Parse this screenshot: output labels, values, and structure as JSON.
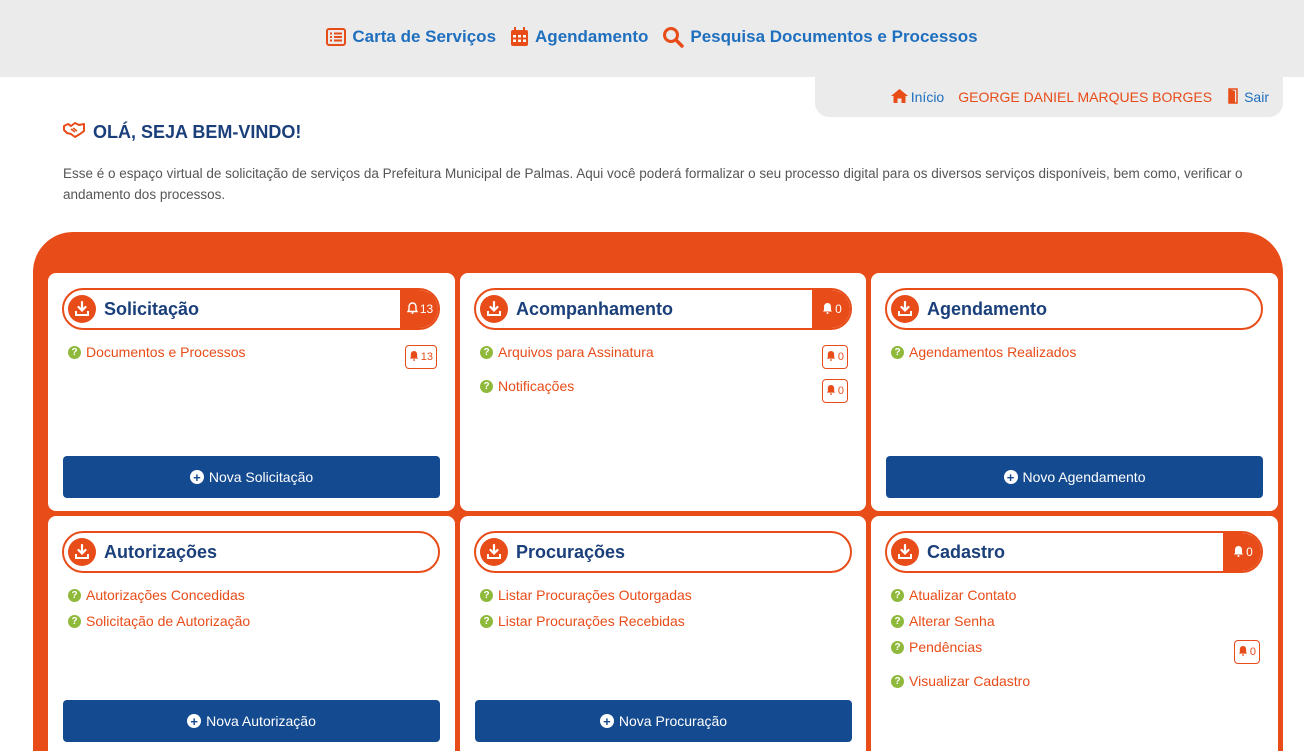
{
  "topnav": {
    "services": "Carta de Serviços",
    "schedule": "Agendamento",
    "search": "Pesquisa Documentos e Processos"
  },
  "userbar": {
    "home": "Início",
    "user_name": "GEORGE DANIEL MARQUES BORGES",
    "exit": "Sair"
  },
  "welcome": {
    "title": "OLÁ, SEJA BEM-VINDO!",
    "text": "Esse é o espaço virtual de solicitação de serviços da Prefeitura Municipal de Palmas. Aqui você poderá formalizar o seu processo digital para os diversos serviços disponíveis, bem como, verificar o andamento dos processos."
  },
  "cards": {
    "solicitacao": {
      "title": "Solicitação",
      "badge": "13",
      "links": [
        {
          "label": "Documentos e Processos",
          "count": "13"
        }
      ],
      "button": "Nova Solicitação"
    },
    "acompanhamento": {
      "title": "Acompanhamento",
      "badge": "0",
      "links": [
        {
          "label": "Arquivos para Assinatura",
          "count": "0"
        },
        {
          "label": "Notificações",
          "count": "0"
        }
      ]
    },
    "agendamento": {
      "title": "Agendamento",
      "links": [
        {
          "label": "Agendamentos Realizados"
        }
      ],
      "button": "Novo Agendamento"
    },
    "autorizacoes": {
      "title": "Autorizações",
      "links": [
        {
          "label": "Autorizações Concedidas"
        },
        {
          "label": "Solicitação de Autorização"
        }
      ],
      "button": "Nova Autorização"
    },
    "procuracoes": {
      "title": "Procurações",
      "links": [
        {
          "label": "Listar Procurações Outorgadas"
        },
        {
          "label": "Listar Procurações Recebidas"
        }
      ],
      "button": "Nova Procuração"
    },
    "cadastro": {
      "title": "Cadastro",
      "badge": "0",
      "links": [
        {
          "label": "Atualizar Contato"
        },
        {
          "label": "Alterar Senha"
        },
        {
          "label": "Pendências",
          "count": "0"
        },
        {
          "label": "Visualizar Cadastro"
        }
      ]
    }
  },
  "colors": {
    "accent": "#e84c18",
    "navy": "#144a8f",
    "link_blue": "#1f6fbf",
    "help_green": "#8fb93b"
  },
  "icons": {
    "services": "list-icon",
    "schedule": "calendar-icon",
    "search": "search-icon",
    "home": "home-icon",
    "exit": "door-exit-icon",
    "welcome": "handshake-icon",
    "card": "download-icon",
    "badge": "bell-icon",
    "link": "question-icon",
    "button": "plus-circle-icon"
  }
}
